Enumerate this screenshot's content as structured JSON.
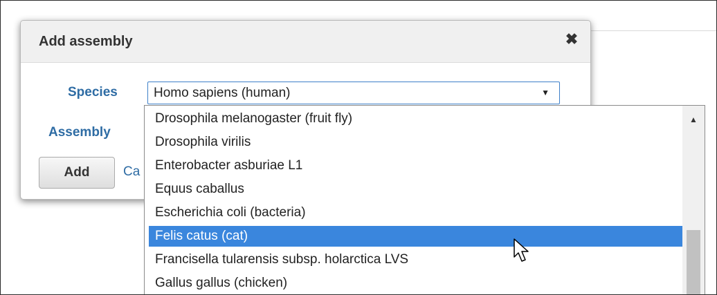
{
  "dialog": {
    "title": "Add assembly",
    "close_icon": "close-icon",
    "species_label": "Species",
    "species_value": "Homo sapiens (human)",
    "assembly_label": "Assembly",
    "add_label": "Add",
    "cancel_label": "Ca"
  },
  "dropdown": {
    "options": [
      "Drosophila melanogaster (fruit fly)",
      "Drosophila virilis",
      "Enterobacter asburiae L1",
      "Equus caballus",
      "Escherichia coli (bacteria)",
      "Felis catus (cat)",
      "Francisella tularensis subsp. holarctica LVS",
      "Gallus gallus (chicken)"
    ],
    "selected_index": 5
  },
  "colors": {
    "label_blue": "#2e6ca4",
    "selection_blue": "#3a86dd"
  }
}
